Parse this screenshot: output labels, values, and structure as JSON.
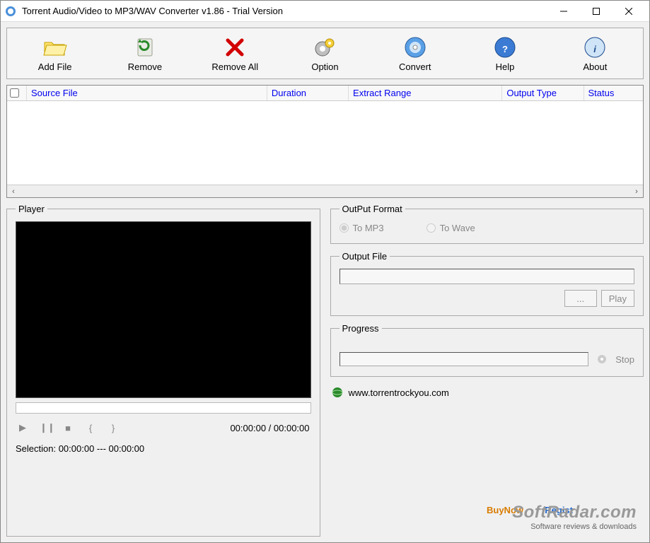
{
  "titlebar": {
    "title": "Torrent Audio/Video to MP3/WAV Converter v1.86 - Trial Version"
  },
  "toolbar": [
    {
      "label": "Add File"
    },
    {
      "label": "Remove"
    },
    {
      "label": "Remove All"
    },
    {
      "label": "Option"
    },
    {
      "label": "Convert"
    },
    {
      "label": "Help"
    },
    {
      "label": "About"
    }
  ],
  "list": {
    "headers": [
      "Source File",
      "Duration",
      "Extract Range",
      "Output Type",
      "Status"
    ]
  },
  "player": {
    "legend": "Player",
    "time": "00:00:00 / 00:00:00",
    "selection": "Selection: 00:00:00 --- 00:00:00"
  },
  "output_format": {
    "legend": "OutPut Format",
    "mp3": "To MP3",
    "wave": "To Wave"
  },
  "output_file": {
    "legend": "Output File",
    "browse": "...",
    "play": "Play"
  },
  "progress": {
    "legend": "Progress",
    "stop": "Stop"
  },
  "footer": {
    "url": "www.torrentrockyou.com",
    "buynow": "BuyNow",
    "regist": "Regist"
  },
  "watermark": {
    "brand": "SoftRadar.com",
    "sub": "Software reviews & downloads"
  }
}
